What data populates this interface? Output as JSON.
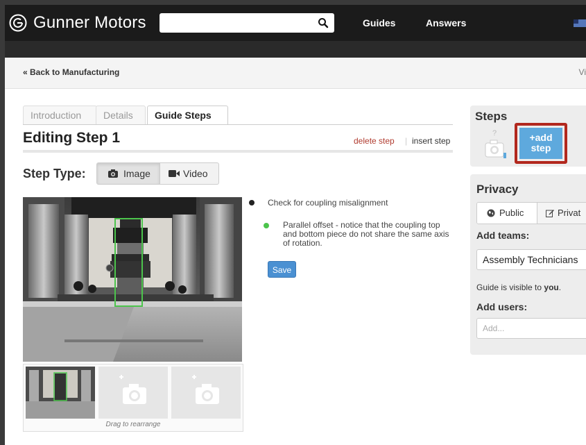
{
  "header": {
    "brand": "Gunner Motors",
    "search": {
      "value": "",
      "placeholder": ""
    },
    "nav": {
      "guides": "Guides",
      "answers": "Answers"
    }
  },
  "breadcrumb": {
    "back": "« Back to Manufacturing",
    "right": "Vi"
  },
  "tabs": [
    {
      "label": "Introduction",
      "active": false
    },
    {
      "label": "Details",
      "active": false
    },
    {
      "label": "Guide Steps",
      "active": true
    }
  ],
  "editor": {
    "title": "Editing Step 1",
    "delete_step": "delete step",
    "separator": "|",
    "insert_step": "insert step",
    "step_type_label": "Step Type:",
    "step_types": {
      "image": "Image",
      "video": "Video",
      "selected": "Image"
    },
    "bullets": [
      {
        "text": "Check for coupling misalignment",
        "color": "#222222",
        "level": 0
      },
      {
        "text": "Parallel offset - notice that the coupling top and bottom piece do not share the same axis of rotation.",
        "color": "#4cc44c",
        "level": 1
      }
    ],
    "save_label": "Save",
    "drag_hint": "Drag to rearrange"
  },
  "sidebar": {
    "steps": {
      "title": "Steps",
      "add_step": [
        "+add",
        "step"
      ],
      "placeholder_symbol": "?"
    },
    "privacy": {
      "title": "Privacy",
      "public_label": "Public",
      "private_label": "Privat",
      "add_teams_label": "Add teams:",
      "team_value": "Assembly Technicians",
      "visible_prefix": "Guide is visible to ",
      "visible_who": "you",
      "visible_suffix": ".",
      "add_users_label": "Add users:",
      "add_users_placeholder": "Add..."
    }
  },
  "colors": {
    "topbar": "#1b1b1b",
    "delete_link": "#b03a2e",
    "add_step_button": "#5ea9dd",
    "highlight_outline": "#b2281e",
    "save_button": "#4a90d2",
    "annotation_box": "#4cc44c"
  },
  "icons": [
    "logo-icon",
    "search-icon",
    "flag-icon",
    "camera-icon",
    "video-camera-icon",
    "globe-icon",
    "edit-icon",
    "add-photo-icon"
  ]
}
